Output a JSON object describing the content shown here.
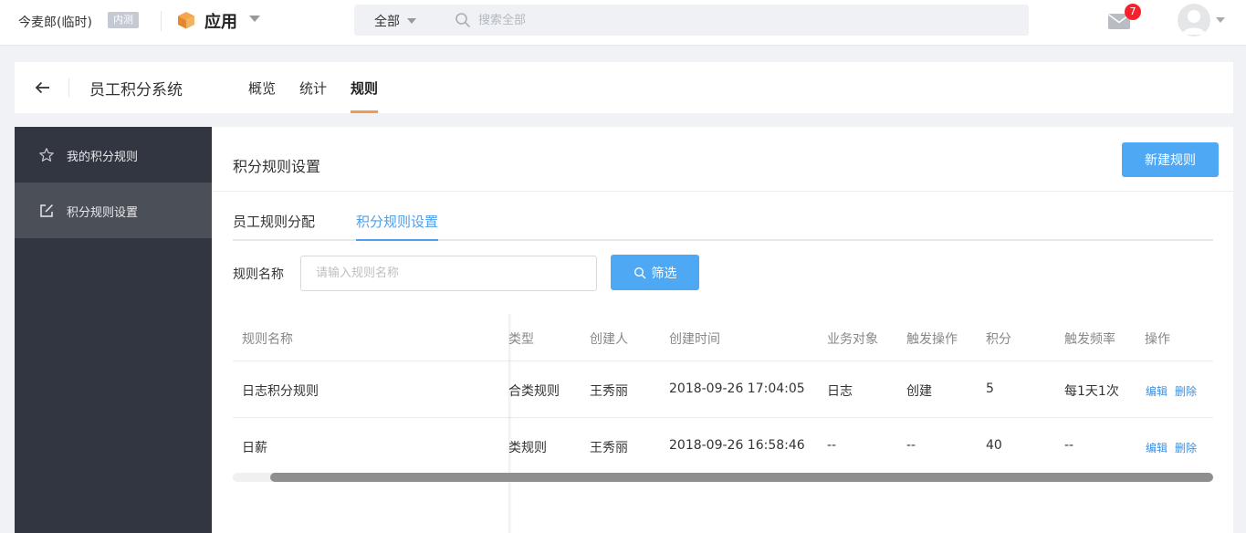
{
  "topbar": {
    "org_name": "今麦郎(临时)",
    "org_badge": "内测",
    "app_label": "应用",
    "search_scope": "全部",
    "search_placeholder": "搜索全部",
    "mail_count": "7",
    "icons": [
      "cube-icon",
      "chevron-down-icon",
      "search-icon",
      "mail-icon",
      "avatar"
    ]
  },
  "header": {
    "system_title": "员工积分系统",
    "tabs": [
      {
        "label": "概览",
        "active": false
      },
      {
        "label": "统计",
        "active": false
      },
      {
        "label": "规则",
        "active": true
      }
    ]
  },
  "sidebar": {
    "items": [
      {
        "label": "我的积分规则",
        "icon": "star-icon",
        "active": false
      },
      {
        "label": "积分规则设置",
        "icon": "edit-icon",
        "active": true
      }
    ]
  },
  "main": {
    "title": "积分规则设置",
    "new_button": "新建规则",
    "subtabs": [
      {
        "label": "员工规则分配",
        "active": false
      },
      {
        "label": "积分规则设置",
        "active": true
      }
    ],
    "filter": {
      "label": "规则名称",
      "placeholder": "请输入规则名称",
      "button": "筛选"
    },
    "table": {
      "headers": [
        "规则名称",
        "类型",
        "创建人",
        "创建时间",
        "业务对象",
        "触发操作",
        "积分",
        "触发频率",
        "操作"
      ],
      "rows": [
        {
          "name": "日志积分规则",
          "type": "合类规则",
          "creator": "王秀丽",
          "created": "2018-09-26 17:04:05",
          "object": "日志",
          "trigger": "创建",
          "points": "5",
          "frequency": "每1天1次",
          "edit": "编辑",
          "delete": "删除"
        },
        {
          "name": "日薪",
          "type": "类规则",
          "creator": "王秀丽",
          "created": "2018-09-26 16:58:46",
          "object": "--",
          "trigger": "--",
          "points": "40",
          "frequency": "--",
          "edit": "编辑",
          "delete": "删除"
        }
      ]
    }
  },
  "colors": {
    "primary": "#4ea8f4",
    "tab_accent": "#f2994a",
    "sidebar_bg": "#323640",
    "sidebar_active": "#4b4f58",
    "badge_red": "#f5222d"
  }
}
